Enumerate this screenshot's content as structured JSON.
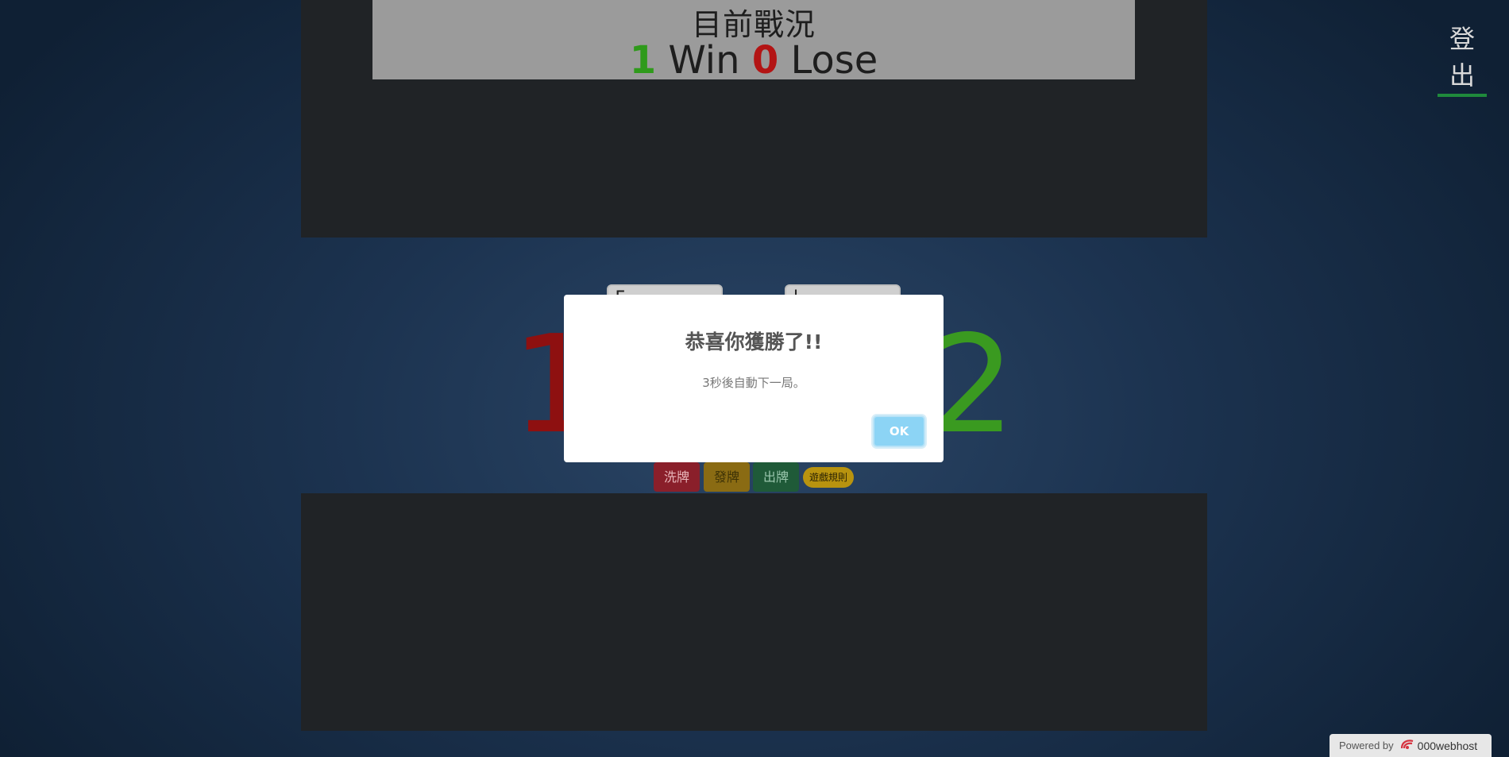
{
  "scoreboard": {
    "title": "目前戰況",
    "wins": "1",
    "win_label": "Win",
    "losses": "0",
    "lose_label": "Lose"
  },
  "header": {
    "logout_label": "登出"
  },
  "table": {
    "card_left_text": "5",
    "card_right_text": "|",
    "left_number": "1",
    "right_number": "2"
  },
  "controls": {
    "shuffle_label": "洗牌",
    "deal_label": "發牌",
    "play_label": "出牌",
    "rules_label": "遊戲規則"
  },
  "modal": {
    "title": "恭喜你獲勝了!!",
    "message": "3秒後自動下一局。",
    "ok_label": "OK"
  },
  "footer": {
    "powered_prefix": "Powered by",
    "powered_brand": "000webhost"
  }
}
